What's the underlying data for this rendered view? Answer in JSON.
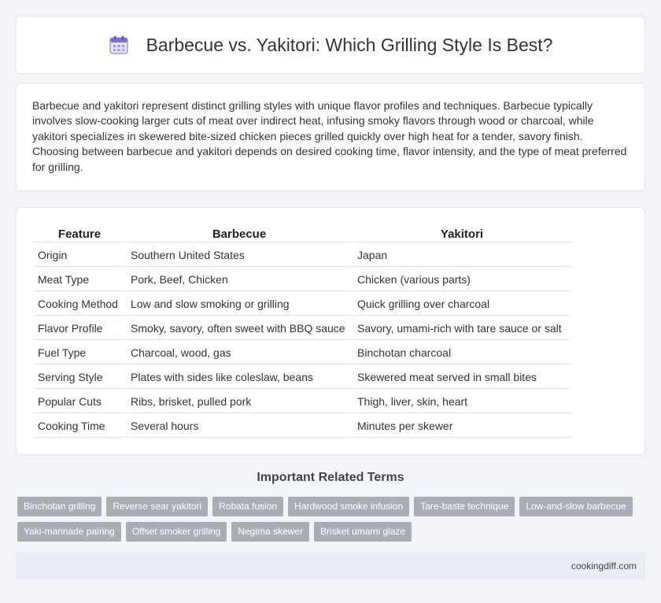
{
  "header": {
    "title": "Barbecue vs. Yakitori: Which Grilling Style Is Best?",
    "icon": "calendar-icon"
  },
  "intro": {
    "text": "Barbecue and yakitori represent distinct grilling styles with unique flavor profiles and techniques. Barbecue typically involves slow-cooking larger cuts of meat over indirect heat, infusing smoky flavors through wood or charcoal, while yakitori specializes in skewered bite-sized chicken pieces grilled quickly over high heat for a tender, savory finish. Choosing between barbecue and yakitori depends on desired cooking time, flavor intensity, and the type of meat preferred for grilling."
  },
  "table": {
    "headers": [
      "Feature",
      "Barbecue",
      "Yakitori"
    ],
    "rows": [
      [
        "Origin",
        "Southern United States",
        "Japan"
      ],
      [
        "Meat Type",
        "Pork, Beef, Chicken",
        "Chicken (various parts)"
      ],
      [
        "Cooking Method",
        "Low and slow smoking or grilling",
        "Quick grilling over charcoal"
      ],
      [
        "Flavor Profile",
        "Smoky, savory, often sweet with BBQ sauce",
        "Savory, umami-rich with tare sauce or salt"
      ],
      [
        "Fuel Type",
        "Charcoal, wood, gas",
        "Binchotan charcoal"
      ],
      [
        "Serving Style",
        "Plates with sides like coleslaw, beans",
        "Skewered meat served in small bites"
      ],
      [
        "Popular Cuts",
        "Ribs, brisket, pulled pork",
        "Thigh, liver, skin, heart"
      ],
      [
        "Cooking Time",
        "Several hours",
        "Minutes per skewer"
      ]
    ]
  },
  "related": {
    "heading": "Important Related Terms",
    "terms": [
      "Binchotan grilling",
      "Reverse sear yakitori",
      "Robata fusion",
      "Hardwood smoke infusion",
      "Tare-baste technique",
      "Low-and-slow barbecue",
      "Yaki-marinade pairing",
      "Offset smoker grilling",
      "Negima skewer",
      "Brisket umami glaze"
    ]
  },
  "footer": {
    "site": "cookingdiff.com"
  },
  "colors": {
    "tag_bg": "#a9adb5",
    "footer_bg": "#e9ecf5",
    "icon_accent": "#7b6fd8"
  }
}
